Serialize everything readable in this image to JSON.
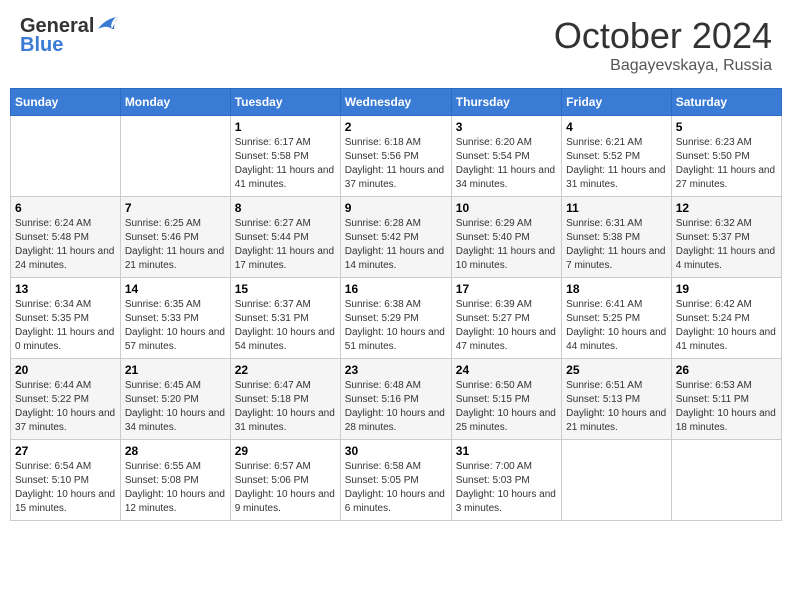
{
  "header": {
    "logo_general": "General",
    "logo_blue": "Blue",
    "month": "October 2024",
    "location": "Bagayevskaya, Russia"
  },
  "weekdays": [
    "Sunday",
    "Monday",
    "Tuesday",
    "Wednesday",
    "Thursday",
    "Friday",
    "Saturday"
  ],
  "weeks": [
    [
      {
        "day": "",
        "sunrise": "",
        "sunset": "",
        "daylight": ""
      },
      {
        "day": "",
        "sunrise": "",
        "sunset": "",
        "daylight": ""
      },
      {
        "day": "1",
        "sunrise": "Sunrise: 6:17 AM",
        "sunset": "Sunset: 5:58 PM",
        "daylight": "Daylight: 11 hours and 41 minutes."
      },
      {
        "day": "2",
        "sunrise": "Sunrise: 6:18 AM",
        "sunset": "Sunset: 5:56 PM",
        "daylight": "Daylight: 11 hours and 37 minutes."
      },
      {
        "day": "3",
        "sunrise": "Sunrise: 6:20 AM",
        "sunset": "Sunset: 5:54 PM",
        "daylight": "Daylight: 11 hours and 34 minutes."
      },
      {
        "day": "4",
        "sunrise": "Sunrise: 6:21 AM",
        "sunset": "Sunset: 5:52 PM",
        "daylight": "Daylight: 11 hours and 31 minutes."
      },
      {
        "day": "5",
        "sunrise": "Sunrise: 6:23 AM",
        "sunset": "Sunset: 5:50 PM",
        "daylight": "Daylight: 11 hours and 27 minutes."
      }
    ],
    [
      {
        "day": "6",
        "sunrise": "Sunrise: 6:24 AM",
        "sunset": "Sunset: 5:48 PM",
        "daylight": "Daylight: 11 hours and 24 minutes."
      },
      {
        "day": "7",
        "sunrise": "Sunrise: 6:25 AM",
        "sunset": "Sunset: 5:46 PM",
        "daylight": "Daylight: 11 hours and 21 minutes."
      },
      {
        "day": "8",
        "sunrise": "Sunrise: 6:27 AM",
        "sunset": "Sunset: 5:44 PM",
        "daylight": "Daylight: 11 hours and 17 minutes."
      },
      {
        "day": "9",
        "sunrise": "Sunrise: 6:28 AM",
        "sunset": "Sunset: 5:42 PM",
        "daylight": "Daylight: 11 hours and 14 minutes."
      },
      {
        "day": "10",
        "sunrise": "Sunrise: 6:29 AM",
        "sunset": "Sunset: 5:40 PM",
        "daylight": "Daylight: 11 hours and 10 minutes."
      },
      {
        "day": "11",
        "sunrise": "Sunrise: 6:31 AM",
        "sunset": "Sunset: 5:38 PM",
        "daylight": "Daylight: 11 hours and 7 minutes."
      },
      {
        "day": "12",
        "sunrise": "Sunrise: 6:32 AM",
        "sunset": "Sunset: 5:37 PM",
        "daylight": "Daylight: 11 hours and 4 minutes."
      }
    ],
    [
      {
        "day": "13",
        "sunrise": "Sunrise: 6:34 AM",
        "sunset": "Sunset: 5:35 PM",
        "daylight": "Daylight: 11 hours and 0 minutes."
      },
      {
        "day": "14",
        "sunrise": "Sunrise: 6:35 AM",
        "sunset": "Sunset: 5:33 PM",
        "daylight": "Daylight: 10 hours and 57 minutes."
      },
      {
        "day": "15",
        "sunrise": "Sunrise: 6:37 AM",
        "sunset": "Sunset: 5:31 PM",
        "daylight": "Daylight: 10 hours and 54 minutes."
      },
      {
        "day": "16",
        "sunrise": "Sunrise: 6:38 AM",
        "sunset": "Sunset: 5:29 PM",
        "daylight": "Daylight: 10 hours and 51 minutes."
      },
      {
        "day": "17",
        "sunrise": "Sunrise: 6:39 AM",
        "sunset": "Sunset: 5:27 PM",
        "daylight": "Daylight: 10 hours and 47 minutes."
      },
      {
        "day": "18",
        "sunrise": "Sunrise: 6:41 AM",
        "sunset": "Sunset: 5:25 PM",
        "daylight": "Daylight: 10 hours and 44 minutes."
      },
      {
        "day": "19",
        "sunrise": "Sunrise: 6:42 AM",
        "sunset": "Sunset: 5:24 PM",
        "daylight": "Daylight: 10 hours and 41 minutes."
      }
    ],
    [
      {
        "day": "20",
        "sunrise": "Sunrise: 6:44 AM",
        "sunset": "Sunset: 5:22 PM",
        "daylight": "Daylight: 10 hours and 37 minutes."
      },
      {
        "day": "21",
        "sunrise": "Sunrise: 6:45 AM",
        "sunset": "Sunset: 5:20 PM",
        "daylight": "Daylight: 10 hours and 34 minutes."
      },
      {
        "day": "22",
        "sunrise": "Sunrise: 6:47 AM",
        "sunset": "Sunset: 5:18 PM",
        "daylight": "Daylight: 10 hours and 31 minutes."
      },
      {
        "day": "23",
        "sunrise": "Sunrise: 6:48 AM",
        "sunset": "Sunset: 5:16 PM",
        "daylight": "Daylight: 10 hours and 28 minutes."
      },
      {
        "day": "24",
        "sunrise": "Sunrise: 6:50 AM",
        "sunset": "Sunset: 5:15 PM",
        "daylight": "Daylight: 10 hours and 25 minutes."
      },
      {
        "day": "25",
        "sunrise": "Sunrise: 6:51 AM",
        "sunset": "Sunset: 5:13 PM",
        "daylight": "Daylight: 10 hours and 21 minutes."
      },
      {
        "day": "26",
        "sunrise": "Sunrise: 6:53 AM",
        "sunset": "Sunset: 5:11 PM",
        "daylight": "Daylight: 10 hours and 18 minutes."
      }
    ],
    [
      {
        "day": "27",
        "sunrise": "Sunrise: 6:54 AM",
        "sunset": "Sunset: 5:10 PM",
        "daylight": "Daylight: 10 hours and 15 minutes."
      },
      {
        "day": "28",
        "sunrise": "Sunrise: 6:55 AM",
        "sunset": "Sunset: 5:08 PM",
        "daylight": "Daylight: 10 hours and 12 minutes."
      },
      {
        "day": "29",
        "sunrise": "Sunrise: 6:57 AM",
        "sunset": "Sunset: 5:06 PM",
        "daylight": "Daylight: 10 hours and 9 minutes."
      },
      {
        "day": "30",
        "sunrise": "Sunrise: 6:58 AM",
        "sunset": "Sunset: 5:05 PM",
        "daylight": "Daylight: 10 hours and 6 minutes."
      },
      {
        "day": "31",
        "sunrise": "Sunrise: 7:00 AM",
        "sunset": "Sunset: 5:03 PM",
        "daylight": "Daylight: 10 hours and 3 minutes."
      },
      {
        "day": "",
        "sunrise": "",
        "sunset": "",
        "daylight": ""
      },
      {
        "day": "",
        "sunrise": "",
        "sunset": "",
        "daylight": ""
      }
    ]
  ]
}
